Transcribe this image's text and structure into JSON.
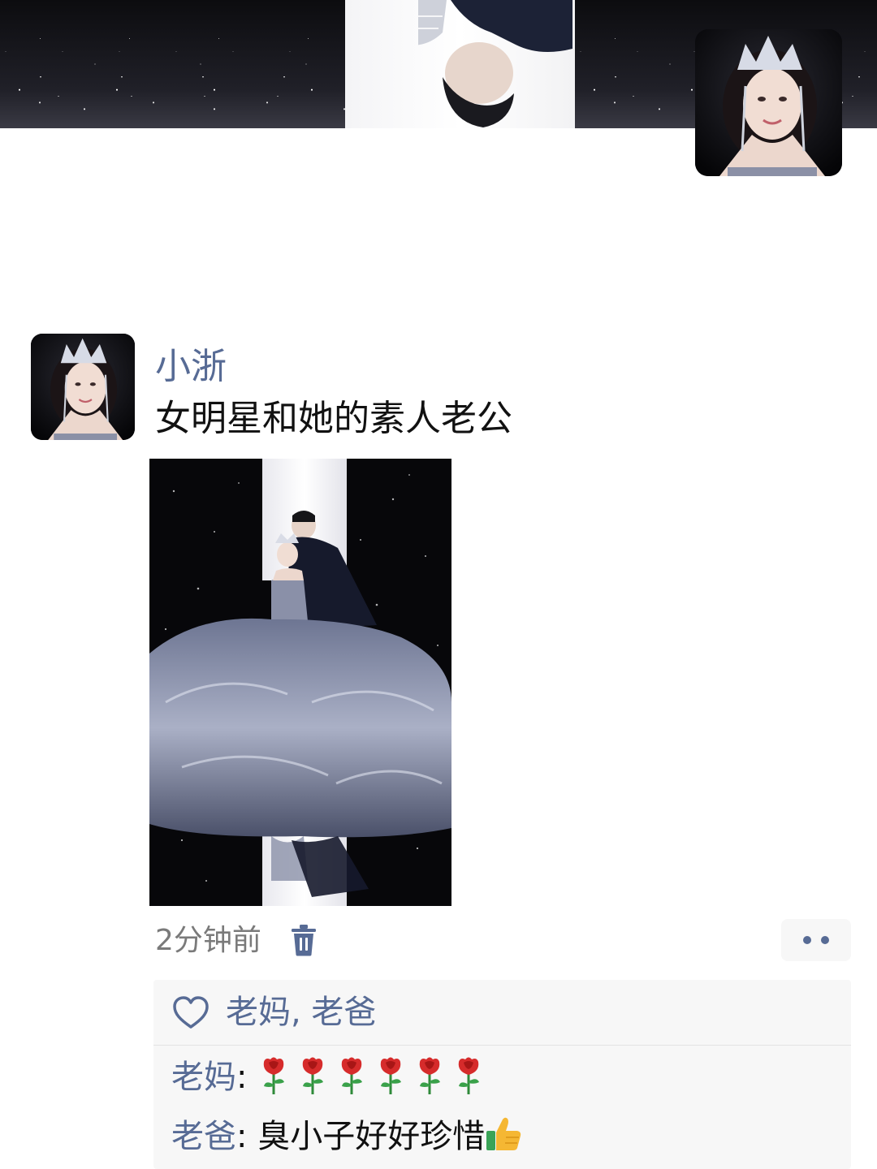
{
  "post": {
    "author": "小浙",
    "text": "女明星和她的素人老公",
    "time": "2分钟前"
  },
  "likes": {
    "names": "老妈, 老爸"
  },
  "comments": [
    {
      "author": "老妈",
      "separator": ": ",
      "text": "🌹🌹🌹🌹🌹🌹",
      "rose_count": 6
    },
    {
      "author": "老爸",
      "separator": ": ",
      "text": "臭小子好好珍惜👍"
    }
  ],
  "comment_2_text": "臭小子好好珍惜",
  "icons": {
    "delete": "trash-icon",
    "more": "more-dots-icon",
    "like": "heart-icon",
    "rose": "rose-emoji",
    "thumb": "thumbs-up-emoji"
  },
  "colors": {
    "link_blue": "#576b95",
    "box_bg": "#f7f7f7",
    "time_gray": "#7a7a7a"
  }
}
